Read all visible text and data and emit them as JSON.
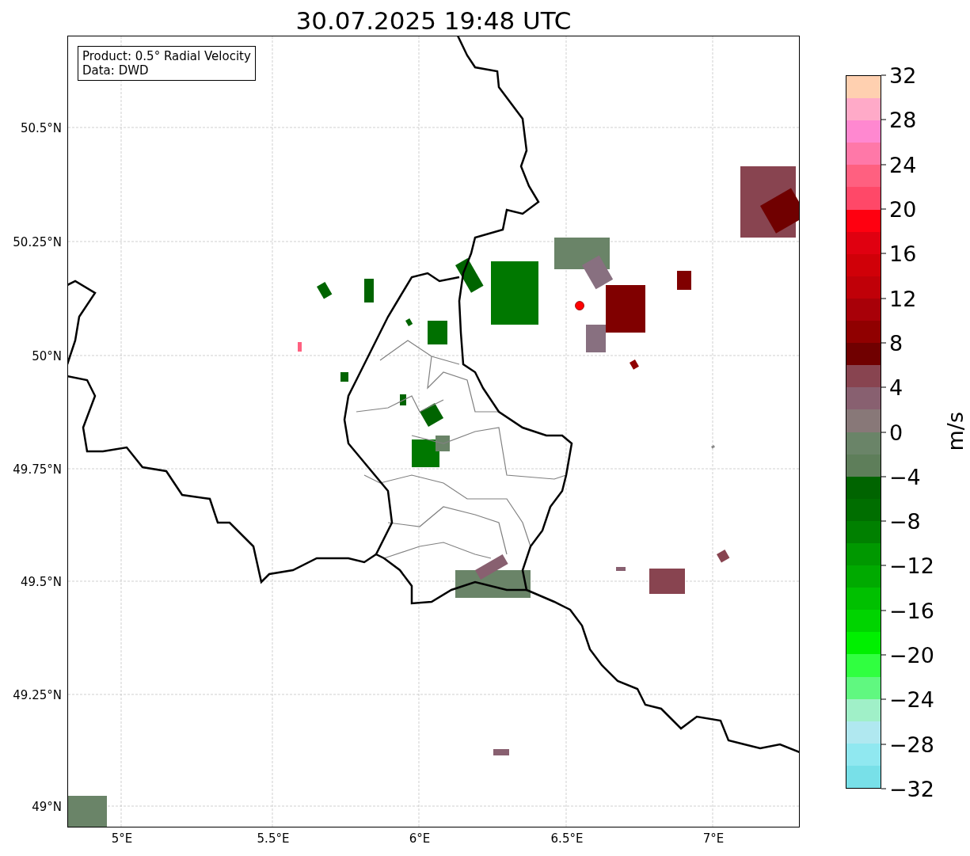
{
  "title": "30.07.2025 19:48 UTC",
  "info_box": {
    "lines": [
      "Product: 0.5° Radial Velocity",
      "Data: DWD"
    ]
  },
  "y_ticks": [
    "50.5°N",
    "50.25°N",
    "50°N",
    "49.75°N",
    "49.5°N",
    "49.25°N",
    "49°N"
  ],
  "x_ticks": [
    "5°E",
    "5.5°E",
    "6°E",
    "6.5°E",
    "7°E"
  ],
  "colorbar": {
    "label": "m/s",
    "ticks": [
      "32",
      "28",
      "24",
      "20",
      "16",
      "12",
      "8",
      "4",
      "0",
      "−4",
      "−8",
      "−12",
      "−16",
      "−20",
      "−24",
      "−28",
      "−32"
    ],
    "segments": [
      {
        "color": "#ffd0b0"
      },
      {
        "color": "#ffaac8"
      },
      {
        "color": "#ff88d0"
      },
      {
        "color": "#ff78a8"
      },
      {
        "color": "#ff6080"
      },
      {
        "color": "#ff4868"
      },
      {
        "color": "#ff0010"
      },
      {
        "color": "#e00010"
      },
      {
        "color": "#d00008"
      },
      {
        "color": "#c00008"
      },
      {
        "color": "#a80008"
      },
      {
        "color": "#900000"
      },
      {
        "color": "#700000"
      },
      {
        "color": "#884450"
      },
      {
        "color": "#886070"
      },
      {
        "color": "#887878"
      },
      {
        "color": "#6a8468"
      },
      {
        "color": "#5e7e5a"
      },
      {
        "color": "#006400"
      },
      {
        "color": "#006e00"
      },
      {
        "color": "#008000"
      },
      {
        "color": "#009800"
      },
      {
        "color": "#00aa00"
      },
      {
        "color": "#00c000"
      },
      {
        "color": "#00d400"
      },
      {
        "color": "#00f000"
      },
      {
        "color": "#30ff40"
      },
      {
        "color": "#60f880"
      },
      {
        "color": "#a0f0c8"
      },
      {
        "color": "#b0e8f0"
      },
      {
        "color": "#90e8f0"
      },
      {
        "color": "#78e0e8"
      }
    ]
  }
}
